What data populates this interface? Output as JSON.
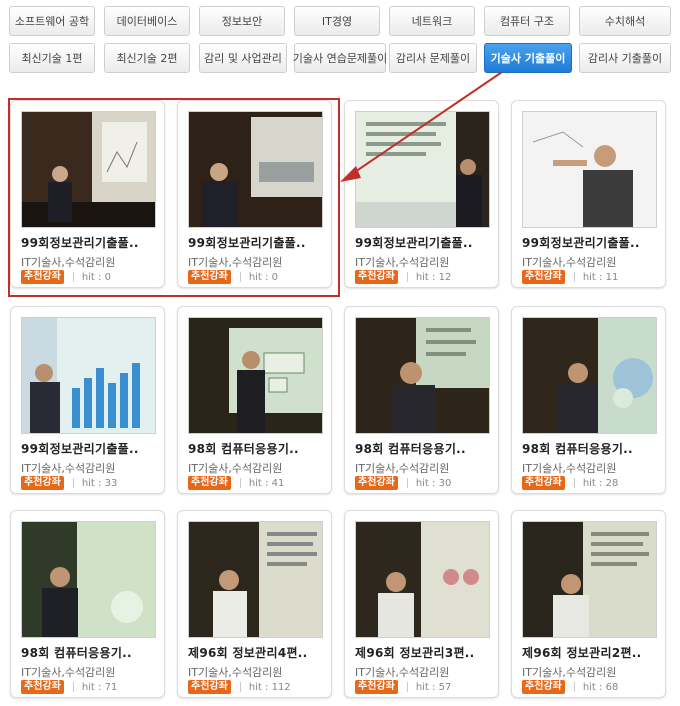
{
  "tabs_row1": [
    "소프트웨어 공학",
    "데이터베이스",
    "정보보안",
    "IT경영",
    "네트워크",
    "컴퓨터 구조",
    "수치해석"
  ],
  "tabs_row2": [
    "최신기술 1편",
    "최신기술 2편",
    "감리 및 사업관리",
    "기술사 연습문제풀이",
    "감리사 문제풀이",
    "기술사 기출풀이",
    "감리사 기출풀이"
  ],
  "active_tab": "기술사 기출풀이",
  "colors": {
    "accent_blue": "#2a86dd",
    "badge_orange": "#e8681a",
    "highlight_red": "#c0302a"
  },
  "cards": [
    {
      "title": "99회정보관리기출풀..",
      "author": "IT기술사,수석감리원",
      "badge": "추천강좌",
      "hit": "hit : 0"
    },
    {
      "title": "99회정보관리기출풀..",
      "author": "IT기술사,수석감리원",
      "badge": "추천강좌",
      "hit": "hit : 0"
    },
    {
      "title": "99회정보관리기출풀..",
      "author": "IT기술사,수석감리원",
      "badge": "추천강좌",
      "hit": "hit : 12"
    },
    {
      "title": "99회정보관리기출풀..",
      "author": "IT기술사,수석감리원",
      "badge": "추천강좌",
      "hit": "hit : 11"
    },
    {
      "title": "99회정보관리기출풀..",
      "author": "IT기술사,수석감리원",
      "badge": "추천강좌",
      "hit": "hit : 33"
    },
    {
      "title": "98회 컴퓨터응용기..",
      "author": "IT기술사,수석감리원",
      "badge": "추천강좌",
      "hit": "hit : 41"
    },
    {
      "title": "98회 컴퓨터응용기..",
      "author": "IT기술사,수석감리원",
      "badge": "추천강좌",
      "hit": "hit : 30"
    },
    {
      "title": "98회 컴퓨터응용기..",
      "author": "IT기술사,수석감리원",
      "badge": "추천강좌",
      "hit": "hit : 28"
    },
    {
      "title": "98회 컴퓨터응용기..",
      "author": "IT기술사,수석감리원",
      "badge": "추천강좌",
      "hit": "hit : 71"
    },
    {
      "title": "제96회 정보관리4편..",
      "author": "IT기술사,수석감리원",
      "badge": "추천강좌",
      "hit": "hit : 112"
    },
    {
      "title": "제96회 정보관리3편..",
      "author": "IT기술사,수석감리원",
      "badge": "추천강좌",
      "hit": "hit : 57"
    },
    {
      "title": "제96회 정보관리2편..",
      "author": "IT기술사,수석감리원",
      "badge": "추천강좌",
      "hit": "hit : 68"
    }
  ]
}
